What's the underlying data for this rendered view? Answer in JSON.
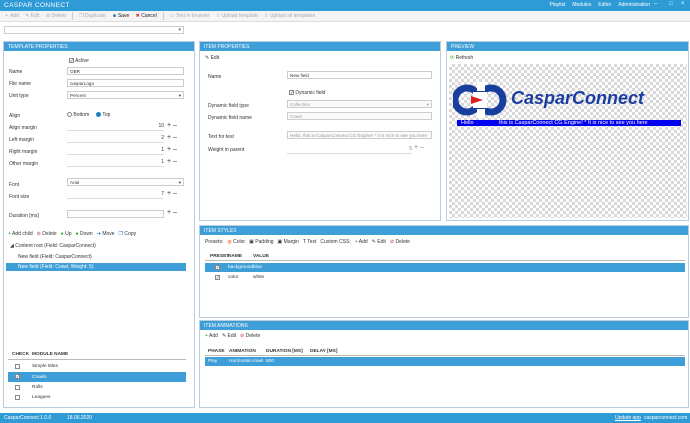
{
  "app": {
    "title": "CASPAR CONNECT",
    "nav": [
      "Playlist",
      "Modules",
      "Editor",
      "Administration"
    ]
  },
  "toolbar": {
    "add": "Add",
    "edit": "Edit",
    "delete": "Delete",
    "duplicate": "Duplicate",
    "save": "Save",
    "cancel": "Cancel",
    "test": "Test in browser",
    "upload": "Upload template",
    "upload_all": "Upload all templates"
  },
  "template": {
    "header": "Template properties",
    "active_label": "Active",
    "name_label": "Name",
    "name_value": "OBR",
    "file_label": "File name",
    "file_value": "casparLogo",
    "unit_label": "Unit type",
    "unit_value": "Percent",
    "align_label": "Align",
    "bottom_label": "Bottom",
    "top_label": "Top",
    "align_margin_label": "Align margin",
    "align_margin": "10",
    "left_margin_label": "Left margin",
    "left_margin": "2",
    "right_margin_label": "Right margin",
    "right_margin": "1",
    "other_margin_label": "Other margin",
    "other_margin": "1",
    "font_label": "Font",
    "font_value": "Arial",
    "font_size_label": "Font size",
    "font_size": "7",
    "duration_label": "Duration [ms]",
    "tree_tb": {
      "add_child": "Add child",
      "delete": "Delete",
      "up": "Up",
      "down": "Down",
      "move": "Move",
      "copy": "Copy"
    },
    "tree": [
      "Content root (Field: CasparConnect)",
      "New field (Field: CasparConnect)",
      "New field (Field: Crawl, Weight: 5)"
    ],
    "modules_head": {
      "check": "CHECK",
      "name": "MODULE NAME"
    },
    "modules": [
      "Simple titles",
      "Crawls",
      "Rolls",
      "Leagues"
    ]
  },
  "item": {
    "header": "Item properties",
    "edit": "Edit",
    "name_label": "Name",
    "name_value": "New field",
    "dyn_label": "Dynamic field",
    "dyn_type_label": "Dynamic field type",
    "dyn_type_value": "Collection",
    "dyn_name_label": "Dynamic field name",
    "dyn_name_value": "Crawl",
    "test_label": "Text for test",
    "test_value": "Hello, this is CasparConnect CG Engine! * It is nice to see you here",
    "weight_label": "Weight in parent",
    "weight_value": "5"
  },
  "preview": {
    "header": "Preview",
    "refresh": "Refresh",
    "logo_text": "CasparConnect",
    "crawl_left": "Hello",
    "crawl_right": "this is CasparConnect CG Engine! * It is nice to see you here"
  },
  "styles": {
    "header": "Item styles",
    "presets": "Presets:",
    "color": "Color",
    "padding": "Padding",
    "margin": "Margin",
    "text": "Text",
    "custom": "Custom CSS:",
    "add": "Add",
    "edit": "Edit",
    "delete": "Delete",
    "head": {
      "preset": "PRESET",
      "name": "NAME",
      "value": "VALUE"
    },
    "rows": [
      {
        "name": "background",
        "value": "blue"
      },
      {
        "name": "color",
        "value": "white"
      }
    ]
  },
  "animations": {
    "header": "Item animations",
    "add": "Add",
    "edit": "Edit",
    "delete": "Delete",
    "head": {
      "phase": "PHASE",
      "animation": "ANIMATION",
      "duration": "DURATION [MS]",
      "delay": "DELAY [MS]"
    },
    "rows": [
      {
        "phase": "Play",
        "animation": "Horizontal crawl",
        "duration": "500",
        "delay": ""
      }
    ]
  },
  "status": {
    "version": "CasparConnect 1.0.0",
    "date": "18.06.2020",
    "update": "Update app",
    "site": "casparconnect.com"
  }
}
